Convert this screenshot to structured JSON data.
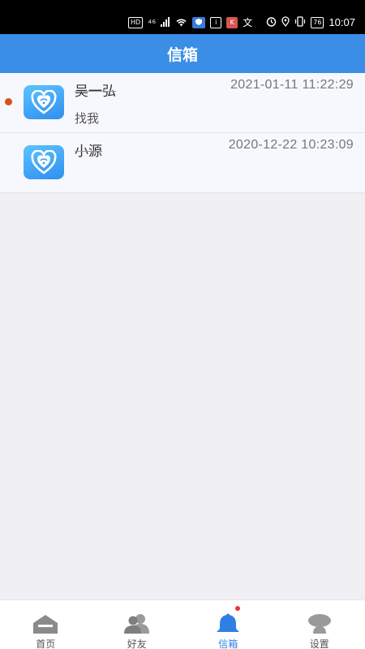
{
  "status_bar": {
    "left_indicators": [
      "HD",
      "⁴⁶",
      "wifi-icon",
      "shield-icon",
      "i",
      "K",
      "文"
    ],
    "right_indicators": [
      "alarm-icon",
      "location-icon",
      "vibrate-icon"
    ],
    "battery": "76",
    "time": "10:07"
  },
  "header": {
    "title": "信箱"
  },
  "colors": {
    "header_bg": "#3a8ee6",
    "accent": "#2f80e5",
    "unread_dot": "#d4541c",
    "badge": "#e53935"
  },
  "messages": [
    {
      "name": "吴一弘",
      "time": "2021-01-11 11:22:29",
      "preview": "找我",
      "unread": true,
      "avatar_icon": "heart-chat-icon"
    },
    {
      "name": "小源",
      "time": "2020-12-22 10:23:09",
      "preview": "",
      "unread": false,
      "avatar_icon": "heart-chat-icon"
    }
  ],
  "tabs": [
    {
      "label": "首页",
      "icon": "home-icon",
      "active": false
    },
    {
      "label": "好友",
      "icon": "friends-icon",
      "active": false
    },
    {
      "label": "信箱",
      "icon": "bell-icon",
      "active": true,
      "badge": true
    },
    {
      "label": "设置",
      "icon": "settings-person-icon",
      "active": false
    }
  ]
}
